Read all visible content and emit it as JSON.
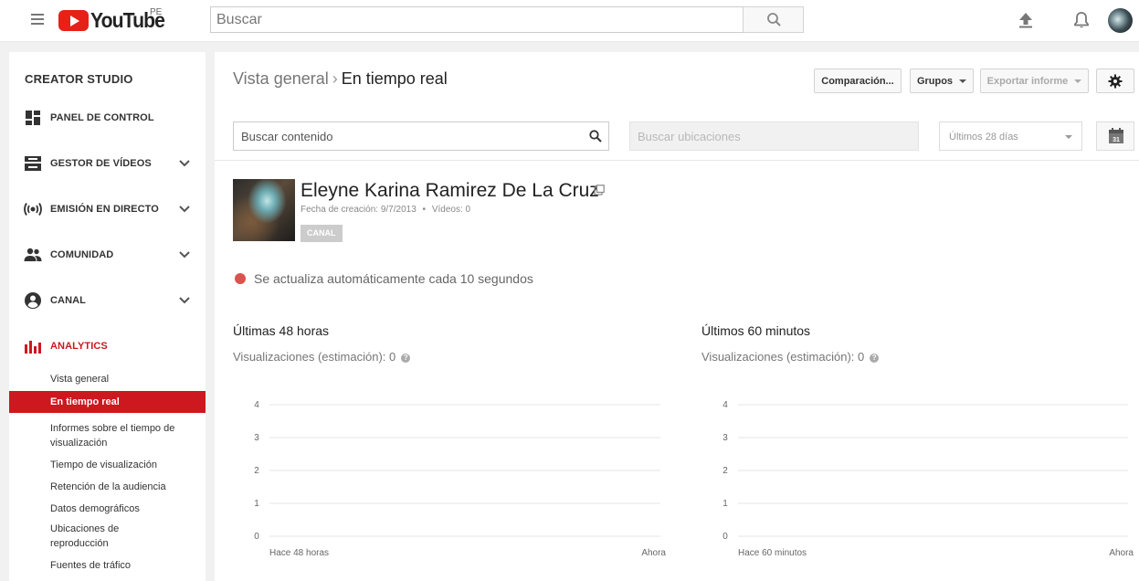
{
  "masthead": {
    "logo_text": "YouTube",
    "country": "PE",
    "search_placeholder": "Buscar"
  },
  "sidebar": {
    "title": "CREATOR STUDIO",
    "items": [
      {
        "label": "PANEL DE CONTROL",
        "icon": "dashboard-icon"
      },
      {
        "label": "GESTOR DE VÍDEOS",
        "icon": "video-manager-icon"
      },
      {
        "label": "EMISIÓN EN DIRECTO",
        "icon": "live-broadcast-icon"
      },
      {
        "label": "COMUNIDAD",
        "icon": "community-icon"
      },
      {
        "label": "CANAL",
        "icon": "channel-icon"
      },
      {
        "label": "ANALYTICS",
        "icon": "analytics-icon"
      }
    ],
    "analytics_subitems": [
      "Vista general",
      "En tiempo real",
      "Informes sobre el tiempo de visualización",
      "Tiempo de visualización",
      "Retención de la audiencia",
      "Datos demográficos",
      "Ubicaciones de reproducción",
      "Fuentes de tráfico"
    ],
    "active_color": "#cc181e"
  },
  "main": {
    "breadcrumb": {
      "root": "Vista general",
      "separator": "›",
      "current": "En tiempo real"
    },
    "buttons": {
      "compare": "Comparación...",
      "groups": "Grupos",
      "export": "Exportar informe"
    },
    "content_search_placeholder": "Buscar contenido",
    "location_search_placeholder": "Buscar ubicaciones",
    "date_range": "Últimos 28 días",
    "calendar_day": "31",
    "channel": {
      "name": "Eleyne Karina Ramirez De La Cruz",
      "created": "Fecha de creación: 9/7/2013",
      "videos": "Vídeos: 0",
      "badge": "CANAL"
    },
    "live_status": "Se actualiza automáticamente cada 10 segundos",
    "live_color": "#d9534f",
    "panels": [
      {
        "title": "Últimas 48 horas",
        "subtitle": "Visualizaciones (estimación): 0"
      },
      {
        "title": "Últimos 60 minutos",
        "subtitle": "Visualizaciones (estimación): 0"
      }
    ]
  },
  "chart_data": [
    {
      "type": "bar",
      "title": "Últimas 48 horas",
      "x_start_label": "Hace 48 horas",
      "x_end_label": "Ahora",
      "y_ticks": [
        0,
        1,
        2,
        3,
        4
      ],
      "ylim": [
        0,
        4
      ],
      "values": [],
      "grid": true
    },
    {
      "type": "bar",
      "title": "Últimos 60 minutos",
      "x_start_label": "Hace 60 minutos",
      "x_end_label": "Ahora",
      "y_ticks": [
        0,
        1,
        2,
        3,
        4
      ],
      "ylim": [
        0,
        4
      ],
      "values": [],
      "grid": true
    }
  ]
}
